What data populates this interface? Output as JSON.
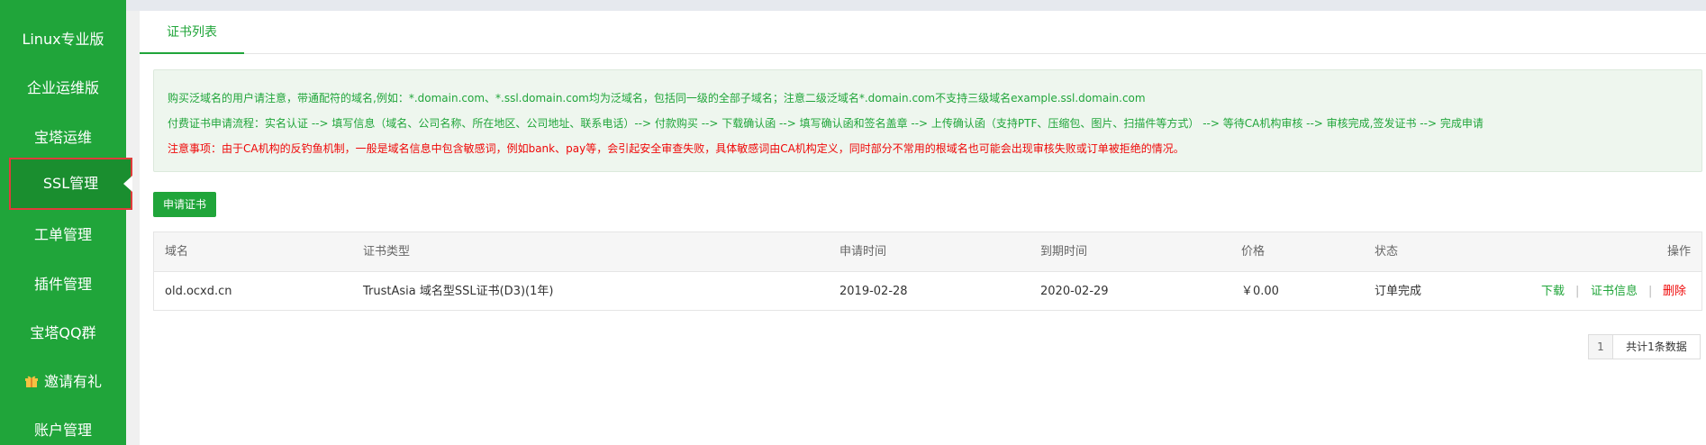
{
  "sidebar": {
    "items": [
      {
        "label": "Linux专业版"
      },
      {
        "label": "企业运维版"
      },
      {
        "label": "宝塔运维"
      },
      {
        "label": "SSL管理"
      },
      {
        "label": "工单管理"
      },
      {
        "label": "插件管理"
      },
      {
        "label": "宝塔QQ群"
      },
      {
        "label": "邀请有礼",
        "icon": "gift-icon"
      },
      {
        "label": "账户管理"
      }
    ],
    "active": "SSL管理"
  },
  "tabs": [
    {
      "label": "证书列表"
    }
  ],
  "notice": {
    "line1": "购买泛域名的用户请注意，带通配符的域名,例如：*.domain.com、*.ssl.domain.com均为泛域名，包括同一级的全部子域名；注意二级泛域名*.domain.com不支持三级域名example.ssl.domain.com",
    "line2": "付费证书申请流程：实名认证 --> 填写信息（域名、公司名称、所在地区、公司地址、联系电话）--> 付款购买 --> 下载确认函 --> 填写确认函和签名盖章 --> 上传确认函（支持PTF、压缩包、图片、扫描件等方式） --> 等待CA机构审核 --> 审核完成,签发证书 --> 完成申请",
    "line3": "注意事项：由于CA机构的反钓鱼机制，一般是域名信息中包含敏感词，例如bank、pay等，会引起安全审查失败，具体敏感词由CA机构定义，同时部分不常用的根域名也可能会出现审核失败或订单被拒绝的情况。"
  },
  "apply_button": "申请证书",
  "table": {
    "headers": {
      "domain": "域名",
      "type": "证书类型",
      "apply_time": "申请时间",
      "expire_time": "到期时间",
      "price": "价格",
      "status": "状态",
      "actions": "操作"
    },
    "rows": [
      {
        "domain": "old.ocxd.cn",
        "type": "TrustAsia 域名型SSL证书(D3)(1年)",
        "apply_time": "2019-02-28",
        "expire_time": "2020-02-29",
        "price": "￥0.00",
        "status": "订单完成",
        "actions": {
          "download": "下载",
          "sep1": "|",
          "info": "证书信息",
          "sep2": "|",
          "delete": "删除"
        }
      }
    ]
  },
  "pager": {
    "page": "1",
    "total": "共计1条数据"
  },
  "colors": {
    "brand": "#20a53a",
    "danger": "#ef0808",
    "highlight_border": "#e03b3b"
  }
}
